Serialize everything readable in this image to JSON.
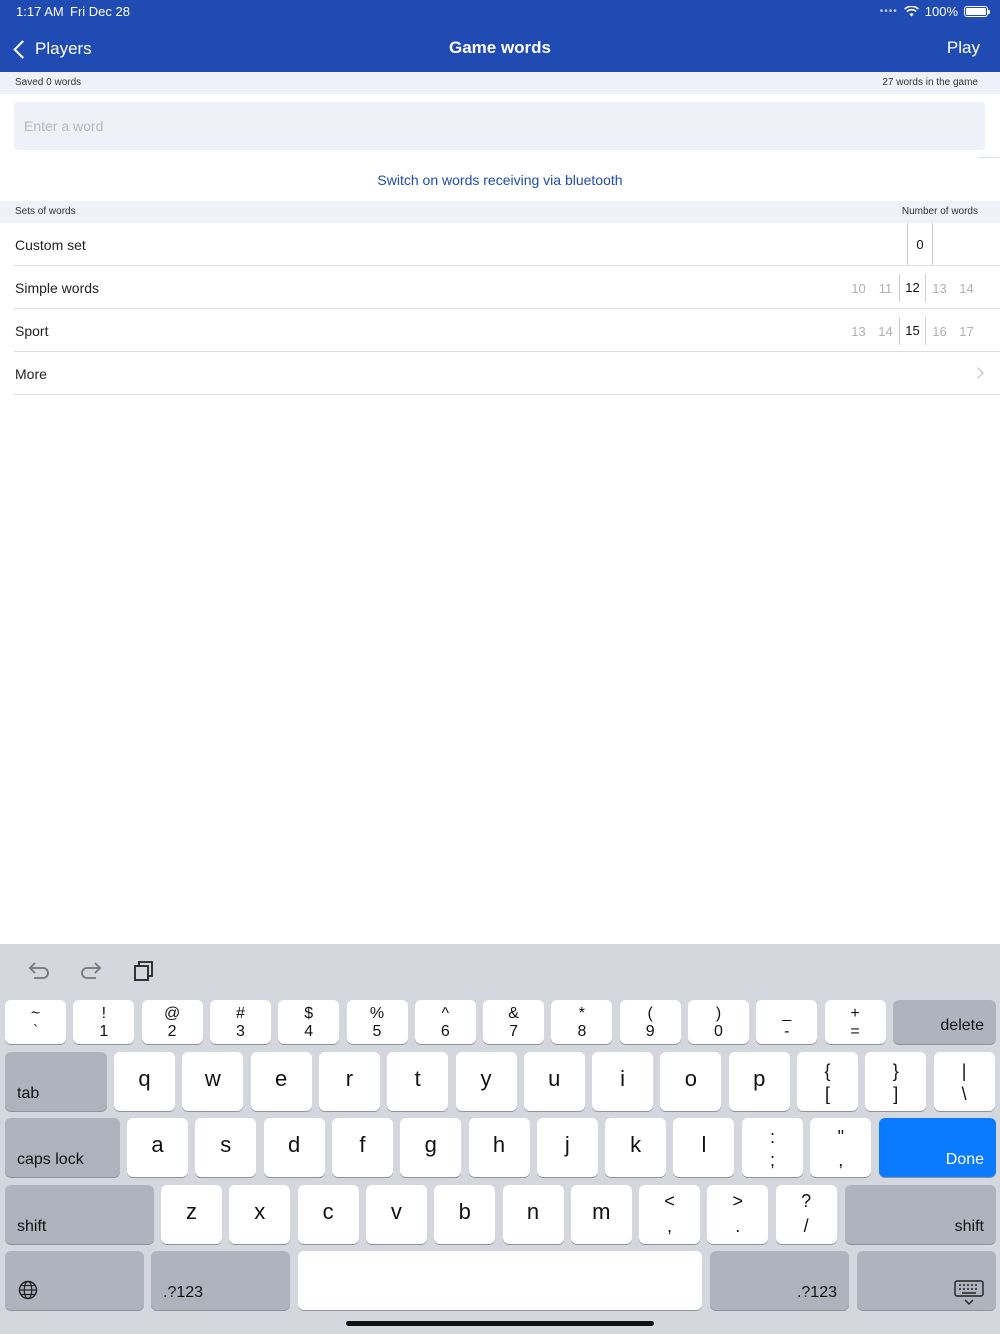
{
  "status_bar": {
    "time": "1:17 AM",
    "date": "Fri Dec 28",
    "battery": "100%"
  },
  "nav": {
    "back_label": "Players",
    "title": "Game words",
    "play_label": "Play"
  },
  "info": {
    "saved": "Saved 0 words",
    "in_game": "27 words in the game"
  },
  "word_input": {
    "placeholder": "Enter a word",
    "value": ""
  },
  "bluetooth_link": "Switch on words receiving via bluetooth",
  "sets_header": {
    "left": "Sets of words",
    "right": "Number of words"
  },
  "sets": {
    "custom": {
      "label": "Custom set",
      "value": "0"
    },
    "simple": {
      "label": "Simple words",
      "prev2": "10",
      "prev1": "11",
      "selected": "12",
      "next1": "13",
      "next2": "14"
    },
    "sport": {
      "label": "Sport",
      "prev2": "13",
      "prev1": "14",
      "selected": "15",
      "next1": "16",
      "next2": "17"
    },
    "more": {
      "label": "More"
    }
  },
  "keyboard": {
    "row1": [
      {
        "top": "~",
        "bot": "`"
      },
      {
        "top": "!",
        "bot": "1"
      },
      {
        "top": "@",
        "bot": "2"
      },
      {
        "top": "#",
        "bot": "3"
      },
      {
        "top": "$",
        "bot": "4"
      },
      {
        "top": "%",
        "bot": "5"
      },
      {
        "top": "^",
        "bot": "6"
      },
      {
        "top": "&",
        "bot": "7"
      },
      {
        "top": "*",
        "bot": "8"
      },
      {
        "top": "(",
        "bot": "9"
      },
      {
        "top": ")",
        "bot": "0"
      },
      {
        "top": "_",
        "bot": "-"
      },
      {
        "top": "+",
        "bot": "="
      }
    ],
    "delete": "delete",
    "tab": "tab",
    "row2": [
      "q",
      "w",
      "e",
      "r",
      "t",
      "y",
      "u",
      "i",
      "o",
      "p"
    ],
    "row2_sym": [
      {
        "top": "{",
        "bot": "["
      },
      {
        "top": "}",
        "bot": "]"
      },
      {
        "top": "|",
        "bot": "\\"
      }
    ],
    "caps": "caps lock",
    "row3": [
      "a",
      "s",
      "d",
      "f",
      "g",
      "h",
      "j",
      "k",
      "l"
    ],
    "row3_sym": [
      {
        "top": ":",
        "bot": ";"
      },
      {
        "top": "\"",
        "bot": ","
      }
    ],
    "done": "Done",
    "shift": "shift",
    "row4": [
      "z",
      "x",
      "c",
      "v",
      "b",
      "n",
      "m"
    ],
    "row4_sym": [
      {
        "top": "<",
        "bot": ","
      },
      {
        "top": ">",
        "bot": "."
      },
      {
        "top": "?",
        "bot": "/"
      }
    ],
    "numbers": ".?123",
    "icons": {
      "undo": "undo-icon",
      "redo": "redo-icon",
      "paste": "paste-icon",
      "globe": "globe-icon",
      "hide": "keyboard-hide-icon"
    }
  },
  "colors": {
    "nav_bar": "#1f4bb2",
    "link": "#1f4bb2",
    "done_key": "#0a7aff"
  }
}
